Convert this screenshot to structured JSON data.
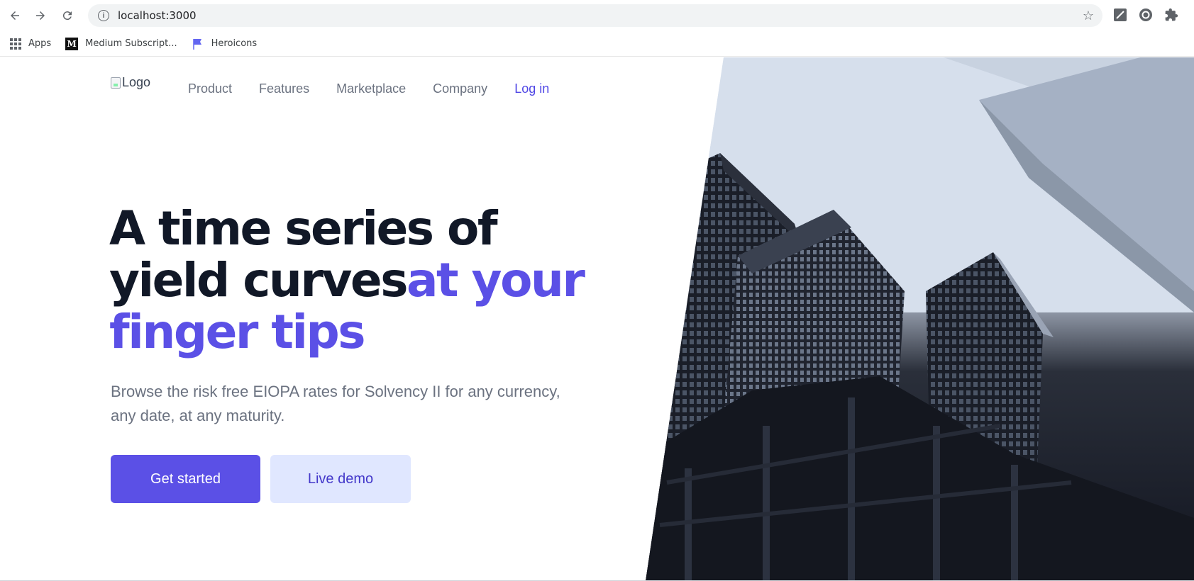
{
  "browser": {
    "url": "localhost:3000",
    "bookmarks": [
      {
        "label": "Apps",
        "icon": "apps-grid-icon"
      },
      {
        "label": "Medium Subscript...",
        "icon": "medium-icon"
      },
      {
        "label": "Heroicons",
        "icon": "flag-icon"
      }
    ]
  },
  "nav": {
    "logo_alt": "Logo",
    "items": [
      "Product",
      "Features",
      "Marketplace",
      "Company"
    ],
    "login": "Log in"
  },
  "hero": {
    "title_part1": "A time series of yield curves",
    "title_accent": "at your finger tips",
    "subtitle": "Browse the risk free EIOPA rates for Solvency II for any currency, any date, at any maturity.",
    "primary_cta": "Get started",
    "secondary_cta": "Live demo"
  },
  "colors": {
    "accent": "#5b50e6",
    "heading": "#111827",
    "muted": "#6b7280",
    "secondary_button_bg": "#e0e7ff"
  }
}
